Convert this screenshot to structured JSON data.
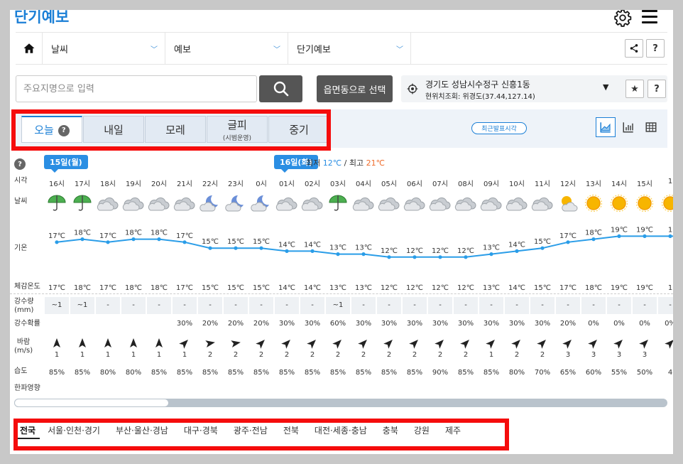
{
  "header": {
    "title": "단기예보"
  },
  "nav": {
    "items": [
      {
        "label": "날씨"
      },
      {
        "label": "예보"
      },
      {
        "label": "단기예보"
      }
    ]
  },
  "search": {
    "placeholder": "주요지명으로 입력",
    "area_button": "읍면동으로 선택"
  },
  "location": {
    "name": "경기도 성남시수정구 신흥1동",
    "coords": "현위치조회: 위경도(37.44,127.14)"
  },
  "buttons": {
    "help": "?",
    "star": "★"
  },
  "tabs": [
    {
      "label": "오늘",
      "sub": ""
    },
    {
      "label": "내일",
      "sub": ""
    },
    {
      "label": "모레",
      "sub": ""
    },
    {
      "label": "글피",
      "sub": "(시범운영)"
    },
    {
      "label": "중기",
      "sub": ""
    }
  ],
  "recent_label": "최근발표시각",
  "dates": [
    {
      "label": "15일(월)",
      "col": 0
    },
    {
      "label": "16일(화)",
      "col": 9
    }
  ],
  "minmax": {
    "min_label": "최저",
    "min": "12℃",
    "sep": "/",
    "max_label": "최고",
    "max": "21℃"
  },
  "row_labels": {
    "time": "시각",
    "weather": "날씨",
    "temp": "기온",
    "feels": "체감온도",
    "precip_1": "강수량",
    "precip_2": "(mm)",
    "prob": "강수확률",
    "wind_1": "바람",
    "wind_2": "(m/s)",
    "humidity": "습도",
    "cold": "한파영향"
  },
  "forecast": {
    "times": [
      "16시",
      "17시",
      "18시",
      "19시",
      "20시",
      "21시",
      "22시",
      "23시",
      "0시",
      "01시",
      "02시",
      "03시",
      "04시",
      "05시",
      "06시",
      "07시",
      "08시",
      "09시",
      "10시",
      "11시",
      "12시",
      "13시",
      "14시",
      "15시",
      "1"
    ],
    "weather": [
      "rain-umbrella",
      "rain-umbrella",
      "cloudy",
      "cloudy",
      "cloudy",
      "cloudy",
      "cloudy-moon",
      "cloudy-moon",
      "cloudy-moon",
      "cloudy",
      "cloudy",
      "rain-umbrella",
      "cloudy",
      "cloudy",
      "cloudy",
      "cloudy",
      "cloudy",
      "cloudy",
      "cloudy",
      "cloudy",
      "partly-sunny",
      "sunny",
      "sunny",
      "sunny",
      "sunny"
    ],
    "temps": [
      17,
      18,
      17,
      18,
      18,
      17,
      15,
      15,
      15,
      14,
      14,
      13,
      13,
      12,
      12,
      12,
      12,
      13,
      14,
      15,
      17,
      18,
      19,
      19,
      19
    ],
    "temp_labels": [
      "17℃",
      "18℃",
      "17℃",
      "18℃",
      "18℃",
      "17℃",
      "15℃",
      "15℃",
      "15℃",
      "14℃",
      "14℃",
      "13℃",
      "13℃",
      "12℃",
      "12℃",
      "12℃",
      "12℃",
      "13℃",
      "14℃",
      "15℃",
      "17℃",
      "18℃",
      "19℃",
      "19℃",
      "1"
    ],
    "feels": [
      "17℃",
      "18℃",
      "17℃",
      "18℃",
      "18℃",
      "17℃",
      "15℃",
      "15℃",
      "15℃",
      "14℃",
      "14℃",
      "13℃",
      "13℃",
      "12℃",
      "12℃",
      "12℃",
      "12℃",
      "13℃",
      "14℃",
      "15℃",
      "17℃",
      "18℃",
      "19℃",
      "19℃",
      "1"
    ],
    "precip": [
      "~1",
      "~1",
      "-",
      "-",
      "-",
      "-",
      "-",
      "-",
      "-",
      "-",
      "-",
      "~1",
      "-",
      "-",
      "-",
      "-",
      "-",
      "-",
      "-",
      "-",
      "-",
      "-",
      "-",
      "-",
      "-"
    ],
    "prob": [
      "",
      "",
      "",
      "",
      "",
      "30%",
      "20%",
      "20%",
      "20%",
      "30%",
      "30%",
      "60%",
      "30%",
      "30%",
      "30%",
      "30%",
      "30%",
      "30%",
      "30%",
      "30%",
      "20%",
      "0%",
      "0%",
      "0%",
      "0%"
    ],
    "wind_dir": [
      180,
      180,
      180,
      180,
      180,
      225,
      260,
      260,
      225,
      225,
      225,
      225,
      225,
      225,
      225,
      225,
      225,
      225,
      225,
      225,
      225,
      225,
      225,
      225,
      225
    ],
    "wind_speed": [
      "1",
      "1",
      "1",
      "1",
      "1",
      "1",
      "2",
      "2",
      "2",
      "2",
      "2",
      "2",
      "2",
      "2",
      "2",
      "2",
      "2",
      "1",
      "2",
      "2",
      "3",
      "3",
      "3",
      "3",
      ""
    ],
    "humidity": [
      "85%",
      "85%",
      "80%",
      "80%",
      "85%",
      "85%",
      "85%",
      "85%",
      "85%",
      "85%",
      "85%",
      "85%",
      "85%",
      "85%",
      "85%",
      "90%",
      "85%",
      "85%",
      "80%",
      "70%",
      "65%",
      "60%",
      "55%",
      "50%",
      "4"
    ]
  },
  "regions": [
    "전국",
    "서울·인천·경기",
    "부산·울산·경남",
    "대구·경북",
    "광주·전남",
    "전북",
    "대전·세종·충남",
    "충북",
    "강원",
    "제주"
  ],
  "colors": {
    "accent": "#1b7fd6",
    "temp_line": "#2a9de8",
    "highlight_red": "#f50c0c",
    "min": "#2a8ee3",
    "max": "#ef6c2b"
  }
}
